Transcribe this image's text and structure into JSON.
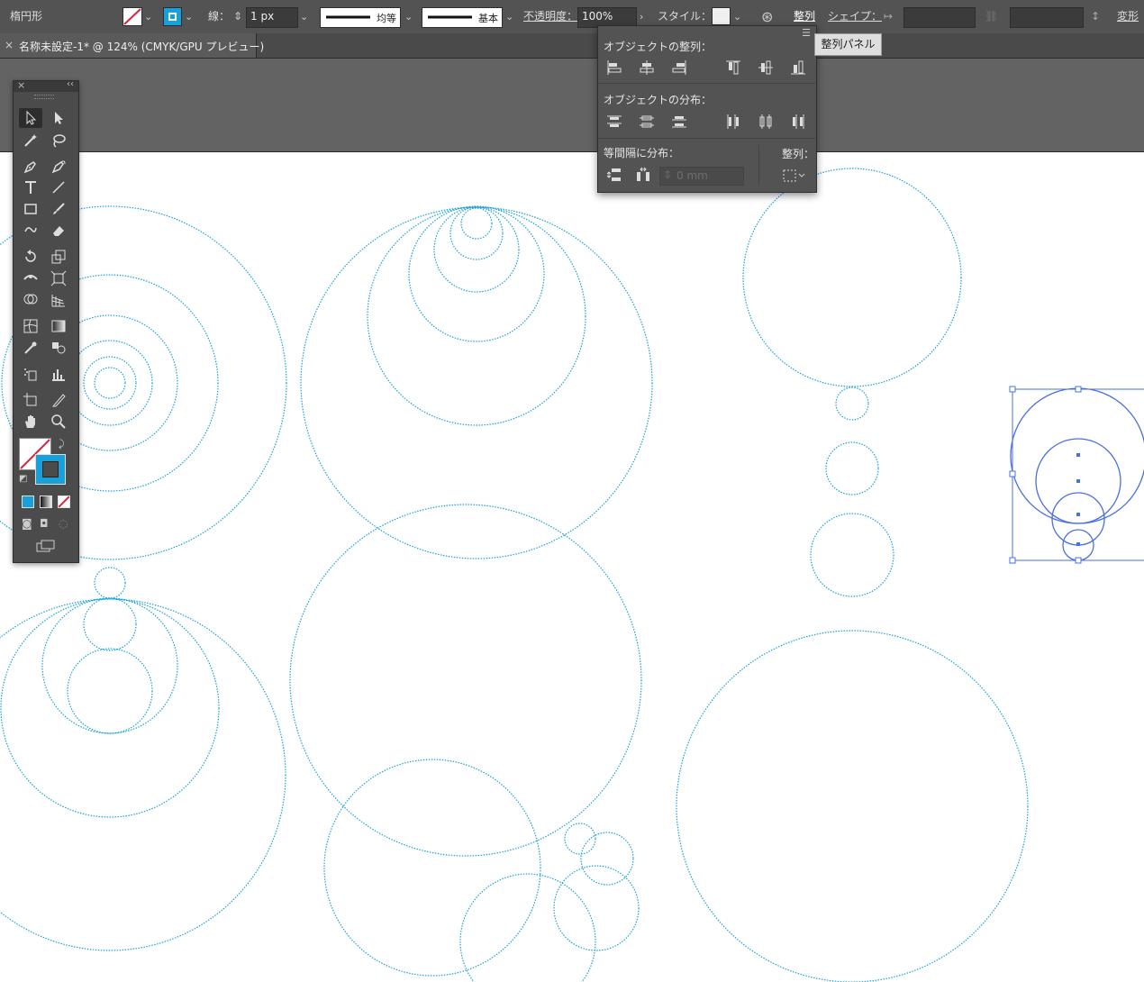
{
  "control_bar": {
    "selection_type": "楕円形",
    "stroke_label": "線：",
    "stroke_weight": "1 px",
    "stroke_profile_1": "均等",
    "stroke_profile_2": "基本",
    "opacity_label": "不透明度：",
    "opacity_value": "100%",
    "style_label": "スタイル：",
    "align_link": "整列",
    "shape_link": "シェイプ：",
    "transform_link": "変形"
  },
  "document_tab": {
    "close": "×",
    "title": "名称未設定-1* @ 124% (CMYK/GPU プレビュー)"
  },
  "align_panel": {
    "align_objects_label": "オブジェクトの整列：",
    "distribute_objects_label": "オブジェクトの分布：",
    "distribute_spacing_label": "等間隔に分布：",
    "align_to_label": "整列：",
    "spacing_value": "0 mm"
  },
  "tooltip": {
    "text": "整列パネル"
  },
  "toolbar": {
    "close": "×",
    "collapse": "‹‹"
  },
  "colors": {
    "ui_dark": "#535353",
    "pasteboard": "#636363",
    "circle_stroke": "#1aa0d8",
    "selection": "#4a70e0",
    "artboard_edge": "#d8263a"
  }
}
